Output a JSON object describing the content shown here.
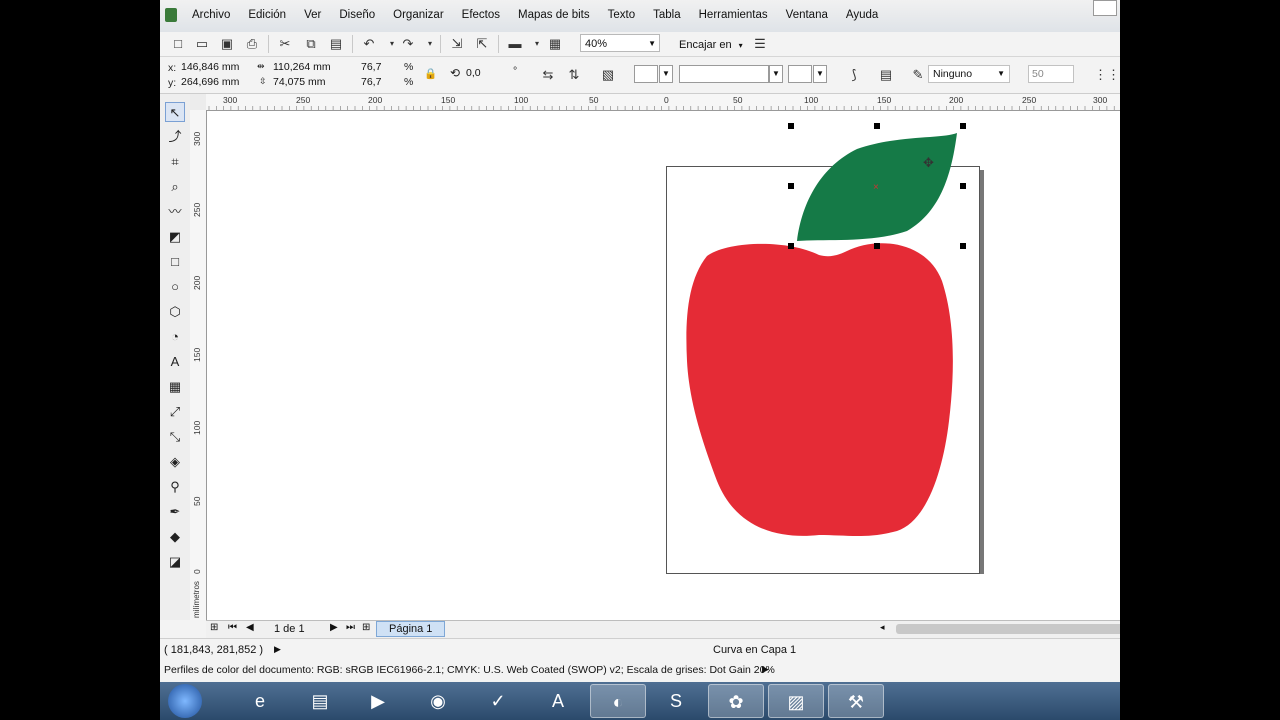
{
  "menu": [
    "Archivo",
    "Edición",
    "Ver",
    "Diseño",
    "Organizar",
    "Efectos",
    "Mapas de bits",
    "Texto",
    "Tabla",
    "Herramientas",
    "Ventana",
    "Ayuda"
  ],
  "toolbar": {
    "zoom": "40%",
    "snap_label": "Encajar en"
  },
  "propbar": {
    "x_label": "x:",
    "x": "146,846 mm",
    "y_label": "y:",
    "y": "264,696 mm",
    "w": "110,264 mm",
    "h": "74,075 mm",
    "scale_x": "76,7",
    "scale_y": "76,7",
    "pct1": "%",
    "pct2": "%",
    "angle": "0,0",
    "deg": "°",
    "outline": "Ninguno",
    "nudge": "50"
  },
  "ruler": {
    "h_labels": [
      "300",
      "250",
      "200",
      "150",
      "100",
      "50",
      "0",
      "50",
      "100",
      "150",
      "200",
      "250",
      "300"
    ],
    "v_labels": [
      "300",
      "250",
      "200",
      "150",
      "100",
      "50",
      "0"
    ],
    "unit": "milímetros"
  },
  "pagenav": {
    "counter": "1 de 1",
    "tab": "Página 1"
  },
  "status": {
    "coords": "( 181,843, 281,852 )",
    "object": "Curva en Capa 1",
    "profiles": "Perfiles de color del documento: RGB: sRGB IEC61966-2.1; CMYK: U.S. Web Coated (SWOP) v2; Escala de grises: Dot Gain 20%"
  },
  "colors": {
    "apple": "#e52b36",
    "leaf": "#157a47",
    "accent": "#cfe1f5"
  },
  "taskbar_icons": [
    "windows-start-icon",
    "internet-explorer-icon",
    "file-explorer-icon",
    "media-player-icon",
    "chrome-icon",
    "todoist-icon",
    "app-a-icon",
    "firefox-icon",
    "skype-icon",
    "corel-icon",
    "photo-icon",
    "tool-icon"
  ]
}
